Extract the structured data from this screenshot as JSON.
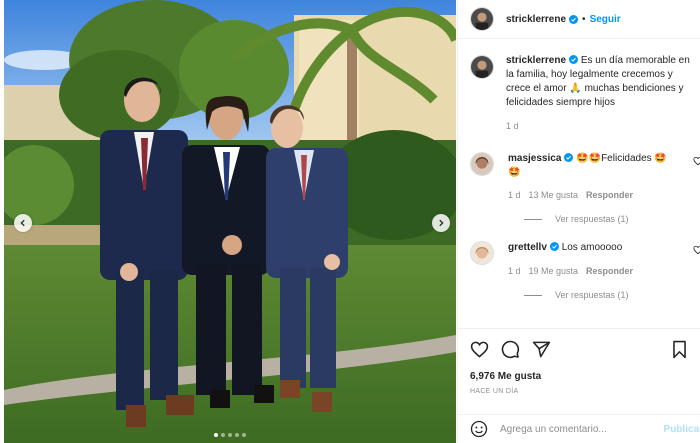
{
  "post": {
    "author": "stricklerrene",
    "follow_label": "Seguir",
    "separator": "•",
    "caption": "Es un día memorable en la familia, hoy legalmente crecemos y crece el amor 🙏 muchas bendiciones y felicidades siempre hijos",
    "caption_time": "1 d",
    "likes": "6,976 Me gusta",
    "posted_ago": "HACE UN DÍA"
  },
  "comments": [
    {
      "user": "masjessica",
      "text": "🤩🤩Felicidades 🤩🤩",
      "time": "1 d",
      "likes": "13 Me gusta",
      "reply_label": "Responder",
      "view_replies": "Ver respuestas (1)"
    },
    {
      "user": "grettellv",
      "text": "Los amooooo",
      "time": "1 d",
      "likes": "19 Me gusta",
      "reply_label": "Responder",
      "view_replies": "Ver respuestas (1)"
    }
  ],
  "composer": {
    "placeholder": "Agrega un comentario...",
    "publish_label": "Publicar"
  },
  "carousel": {
    "slide_count": 5,
    "active_index": 0
  },
  "colors": {
    "accent": "#0095f6",
    "text": "#262626",
    "muted": "#8e8e8e",
    "publish_disabled": "#b2dffc"
  },
  "icons": [
    "verified-badge-icon",
    "heart-icon",
    "comment-icon",
    "share-icon",
    "bookmark-icon",
    "emoji-icon",
    "chevron-left-icon",
    "chevron-right-icon"
  ]
}
